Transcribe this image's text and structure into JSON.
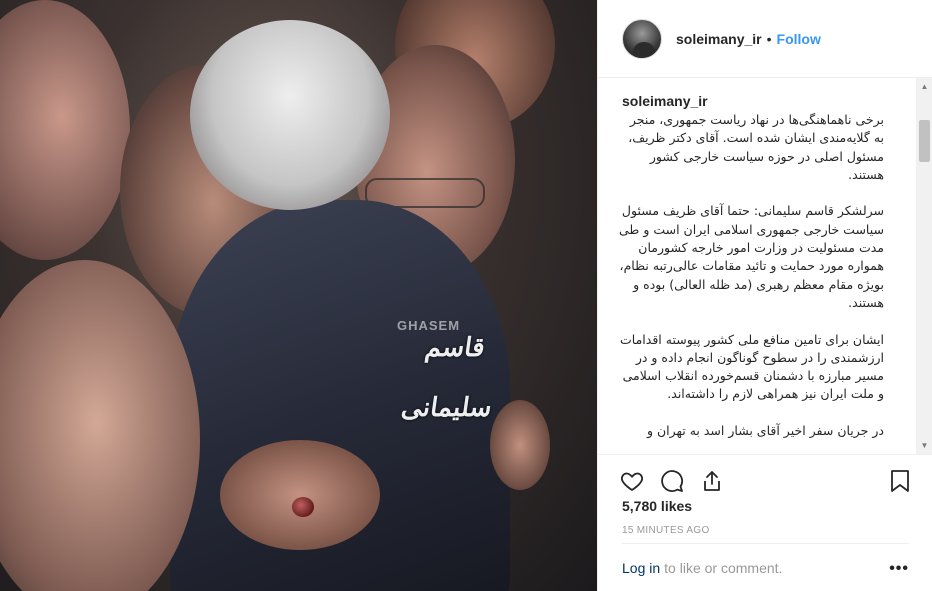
{
  "post": {
    "username": "soleimany_ir",
    "separator": "•",
    "follow_label": "Follow",
    "caption_username": "soleimany_ir",
    "caption": "برخی ناهماهنگی‌ها در نهاد ریاست جمهوری، منجر به گلایه‌مندی ایشان شده است. آقای دکتر ظریف، مسئول اصلی در حوزه سیاست خارجی کشور هستند.\n\nسرلشکر قاسم سلیمانی: حتما آقای ظریف مسئول سیاست خارجی جمهوری اسلامی ایران است و طی مدت مسئولیت در وزارت امور خارجه کشورمان همواره مورد حمایت و تائید مقامات عالی‌رتبه نظام، بویژه مقام معظم رهبری (مد ظله العالی) بوده و هستند.\n\nایشان برای تامین منافع ملی کشور پیوسته اقدامات ارزشمندی را در سطوح گوناگون انجام داده و در مسیر مبارزه با دشمنان قسم‌خورده انقلاب اسلامی و ملت ایران نیز همراهی لازم را داشته‌اند.\n\nدر جریان سفر اخیر آقای بشار اسد به تهران و",
    "likes": "5,780 likes",
    "timestamp": "15 MINUTES AGO",
    "login_label": "Log in",
    "login_rest": "to like or comment.",
    "more_label": "•••"
  },
  "photo": {
    "watermark": "قاسم سلیمانی",
    "watermark_small": "GHASEM"
  },
  "icons": [
    "heart-icon",
    "comment-icon",
    "share-icon",
    "bookmark-icon",
    "more-options-icon"
  ],
  "colors": {
    "link": "#3897f0",
    "login": "#003569",
    "muted": "#999999",
    "border": "#efefef"
  }
}
